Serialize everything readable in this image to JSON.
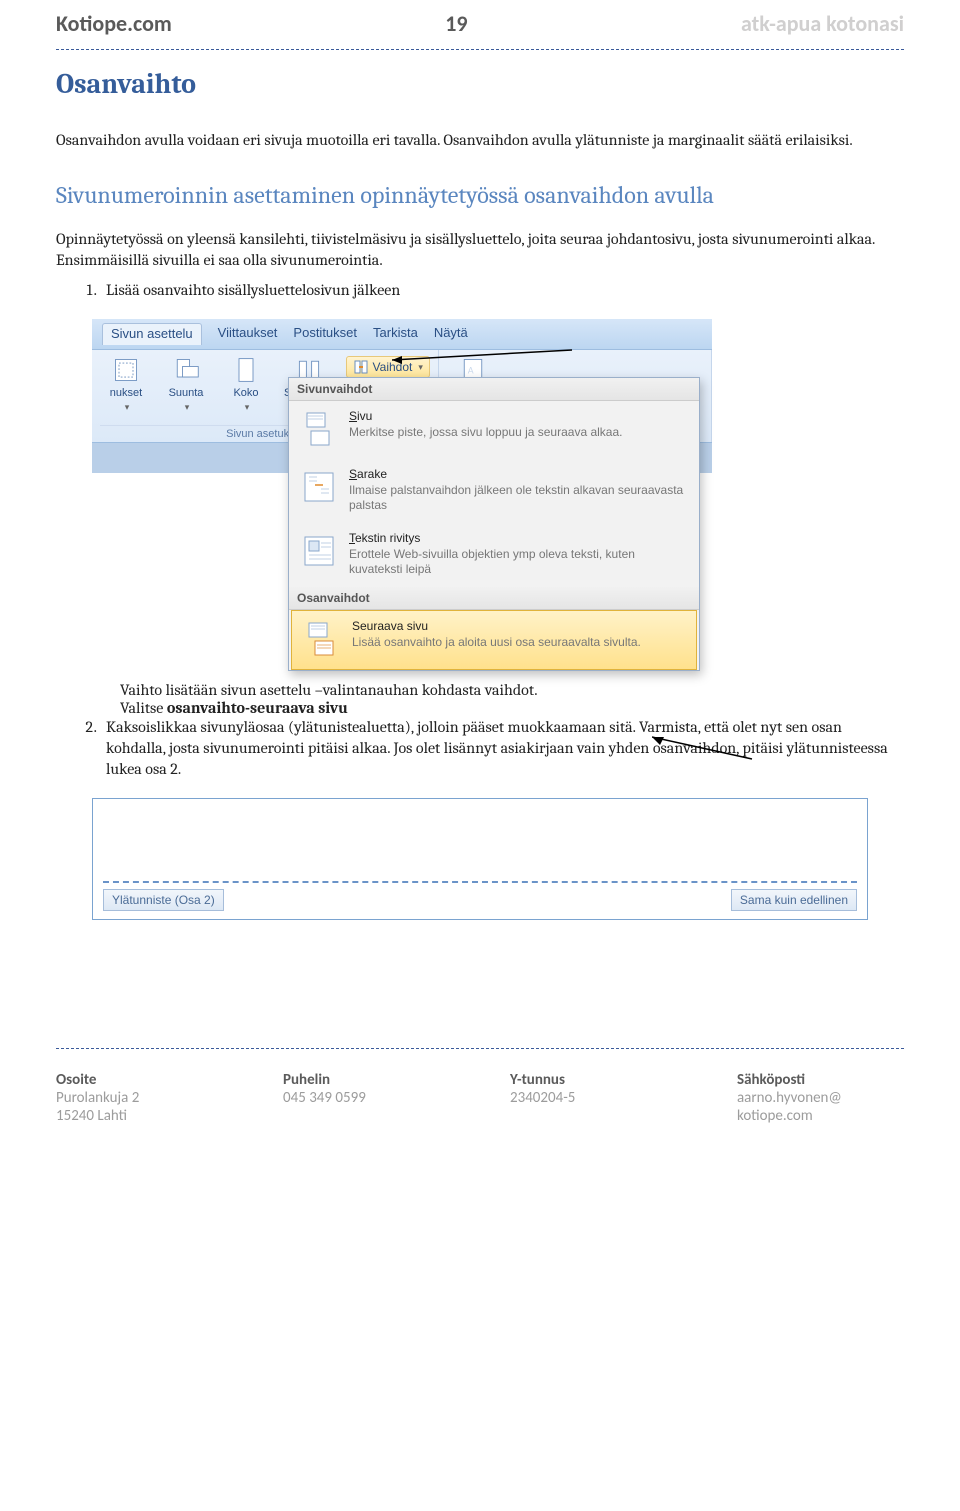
{
  "header": {
    "left": "Kotiope.com",
    "page_number": "19",
    "right": "atk-apua kotonasi"
  },
  "section_title": "Osanvaihto",
  "intro_para": "Osanvaihdon avulla voidaan eri sivuja muotoilla eri tavalla.   Osanvaihdon avulla ylätunniste ja marginaalit säätä erilaisiksi.",
  "sub_title": "Sivunumeroinnin asettaminen opinnäytetyössä osanvaihdon avulla",
  "sub_para": "Opinnäytetyössä on yleensä kansilehti, tiivistelmäsivu ja sisällysluettelo, joita seuraa johdantosivu, josta sivunumerointi alkaa. Ensimmäisillä sivuilla ei saa olla sivunumerointia.",
  "step1": "Lisää osanvaihto sisällysluettelosivun jälkeen",
  "step1_a": "Vaihto lisätään sivun asettelu –valintanauhan kohdasta vaihdot.",
  "step1_b_prefix": "Valitse ",
  "step1_b_bold": "osanvaihto-seuraava sivu",
  "step2": "Kaksoislikkaa sivunyläosaa (ylätunistealuetta), jolloin pääset muokkaamaan sitä. Varmista, että olet nyt sen osan kohdalla, josta sivunumerointi pitäisi alkaa. Jos olet lisännyt asiakirjaan vain yhden osanvaihdon,  pitäisi  ylätunnisteessa lukea osa 2.",
  "ribbon": {
    "tabs": [
      "Sivun asettelu",
      "Viittaukset",
      "Postitukset",
      "Tarkista",
      "Näytä"
    ],
    "buttons": {
      "suunta": "Suunta",
      "koko": "Koko",
      "sarakkeet": "Sarakkeet",
      "nukset": "nukset",
      "vaihdot": "Vaihdot"
    },
    "group_caption": "Sivun asetukset"
  },
  "dropdown": {
    "head1": "Sivunvaihdot",
    "items1": [
      {
        "title_u": "S",
        "title_rest": "ivu",
        "desc": "Merkitse piste, jossa sivu loppuu ja seuraava alkaa."
      },
      {
        "title_u": "S",
        "title_rest": "arake",
        "desc": "Ilmaise palstanvaihdon jälkeen ole tekstin alkavan seuraavasta palstas"
      },
      {
        "title_u": "T",
        "title_rest": "ekstin rivitys",
        "desc": "Erottele Web-sivuilla objektien ymp oleva teksti, kuten kuvateksti leipä"
      }
    ],
    "head2": "Osanvaihdot",
    "items2": [
      {
        "title_u": "",
        "title_rest": "Seuraava sivu",
        "desc": "Lisää osanvaihto ja aloita uusi osa seuraavalta sivulta.",
        "hl": true
      }
    ]
  },
  "shot2": {
    "left_tag": "Ylätunniste (Osa 2)",
    "right_tag": "Sama kuin edellinen"
  },
  "footer": {
    "c1h": "Osoite",
    "c1a": "Purolankuja 2",
    "c1b": "15240 Lahti",
    "c2h": "Puhelin",
    "c2a": "045 349 0599",
    "c3h": "Y-tunnus",
    "c3a": "2340204-5",
    "c4h": "Sähköposti",
    "c4a": "aarno.hyvonen@",
    "c4b": "kotiope.com"
  }
}
